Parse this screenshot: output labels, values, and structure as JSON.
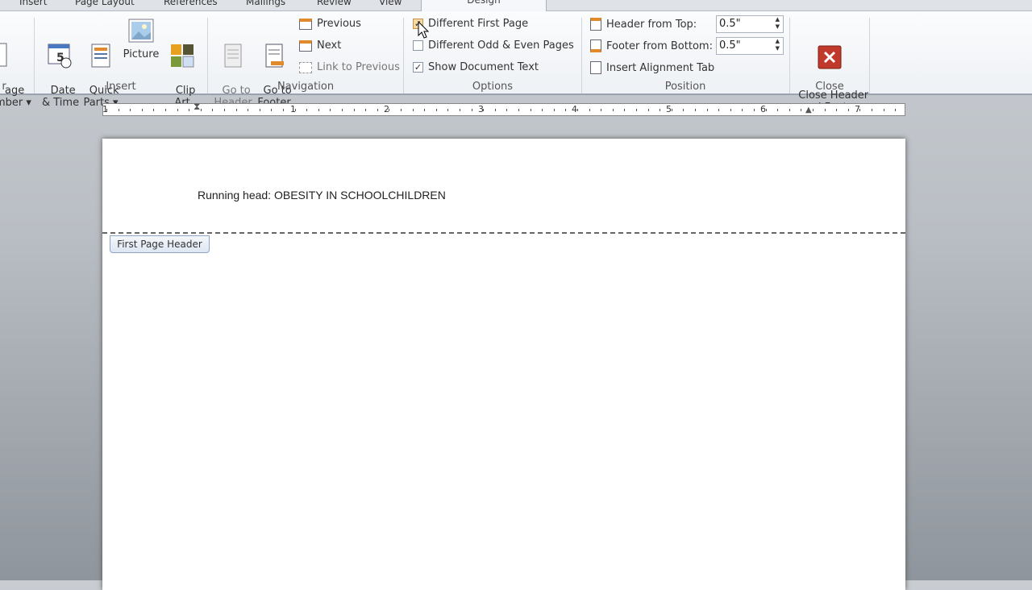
{
  "tabs": [
    {
      "label": "Insert"
    },
    {
      "label": "Page Layout"
    },
    {
      "label": "References"
    },
    {
      "label": "Mailings"
    },
    {
      "label": "Review"
    },
    {
      "label": "View"
    },
    {
      "label": "Design",
      "active": true
    }
  ],
  "groups": {
    "header_footer": {
      "page_number": "age\nmber ▾",
      "label": "r"
    },
    "insert": {
      "label": "Insert",
      "date_time": "Date\n& Time",
      "quick_parts": "Quick\nParts ▾",
      "picture": "Picture",
      "clip_art": "Clip\nArt"
    },
    "navigation": {
      "label": "Navigation",
      "go_header": "Go to\nHeader",
      "go_footer": "Go to\nFooter",
      "previous": "Previous",
      "next": "Next",
      "link_previous": "Link to Previous"
    },
    "options": {
      "label": "Options",
      "different_first": "Different First Page",
      "different_first_checked": true,
      "odd_even": "Different Odd & Even Pages",
      "odd_even_checked": false,
      "show_text": "Show Document Text",
      "show_text_checked": true
    },
    "position": {
      "label": "Position",
      "header_top_label": "Header from Top:",
      "header_top_value": "0.5\"",
      "footer_bottom_label": "Footer from Bottom:",
      "footer_bottom_value": "0.5\"",
      "align_tab": "Insert Alignment Tab"
    },
    "close": {
      "label": "Close",
      "close_btn": "Close Header\nand Footer"
    }
  },
  "ruler": {
    "numbers": [
      "1",
      "1",
      "2",
      "3",
      "4",
      "5",
      "6",
      "7"
    ]
  },
  "document": {
    "running_head": "Running head: OBESITY IN SCHOOLCHILDREN",
    "header_tag": "First Page Header"
  },
  "colors": {
    "close_icon": "#c0392b",
    "ribbon_bg": "#f4f6f9"
  }
}
